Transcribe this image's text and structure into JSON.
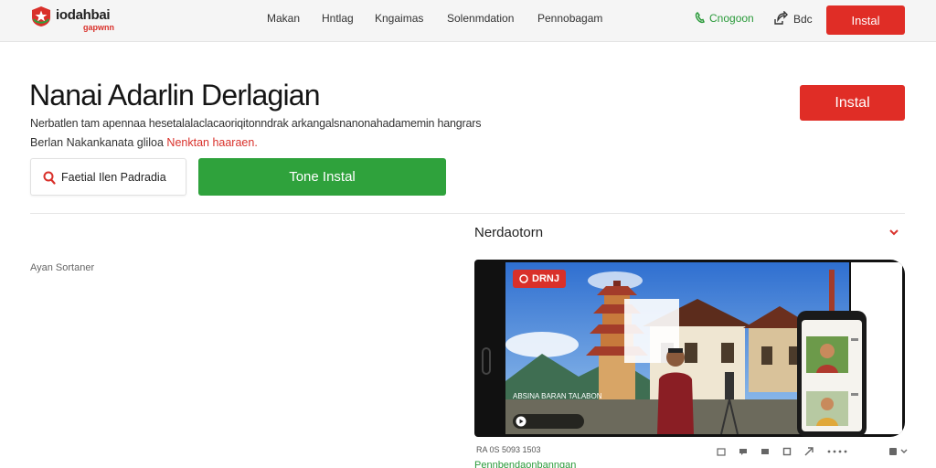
{
  "brand": {
    "name": "iodahbai",
    "subtitle": "gapwnn",
    "logo_color": "#d9302a"
  },
  "nav": {
    "links": [
      "Makan",
      "Hntlag",
      "Kngaimas",
      "Solenmdation",
      "Pennobagam"
    ],
    "green_link": "Cnogoon",
    "share_label": "Bdc",
    "install_label": "Instal"
  },
  "hero": {
    "title": "Nanai Adarlin Derlagian",
    "description_line1": "Nerbatlen tam apennaa hesetalalaclacaoriqitonndrak arkangalsnanonahadamemin hangrars",
    "description_line2_prefix": "Berlan Nakankanata gliloa",
    "description_line2_link": "Nenktan haaraen.",
    "install_label": "Instal",
    "search_label": "Faetial Ilen Padradia",
    "green_button_label": "Tone Instal"
  },
  "left_panel": {
    "note": "Ayan Sortaner"
  },
  "right_panel": {
    "section_title": "Nerdaotorn",
    "screen_badge": "DRNJ",
    "screen_caption": "ABSINA BARAN TALABON ABAHH",
    "stats": "RA 0S 5093 1503",
    "sub_link": "Pennbendaonbanngan"
  },
  "colors": {
    "accent_red": "#e02d26",
    "accent_green": "#2fa23c",
    "link_green": "#2a9a3a"
  },
  "icons": [
    "logo-star-icon",
    "green-phone-icon",
    "share-icon",
    "search-icon",
    "chevron-down-icon",
    "badge-icon",
    "play-icon"
  ]
}
